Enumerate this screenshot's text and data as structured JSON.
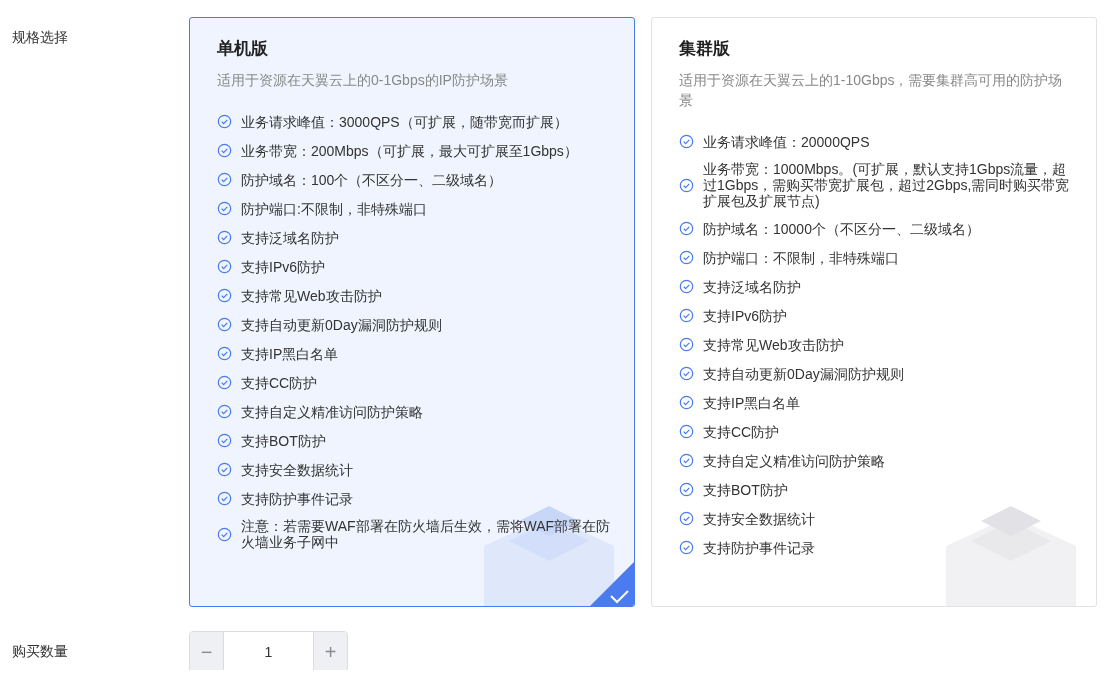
{
  "spec": {
    "label": "规格选择",
    "plans": [
      {
        "title": "单机版",
        "description": "适用于资源在天翼云上的0-1Gbps的IP防护场景",
        "selected": true,
        "features": [
          "业务请求峰值：3000QPS（可扩展，随带宽而扩展）",
          "业务带宽：200Mbps（可扩展，最大可扩展至1Gbps）",
          "防护域名：100个（不区分一、二级域名）",
          "防护端口:不限制，非特殊端口",
          "支持泛域名防护",
          "支持IPv6防护",
          "支持常见Web攻击防护",
          "支持自动更新0Day漏洞防护规则",
          "支持IP黑白名单",
          "支持CC防护",
          "支持自定义精准访问防护策略",
          "支持BOT防护",
          "支持安全数据统计",
          "支持防护事件记录",
          "注意：若需要WAF部署在防火墙后生效，需将WAF部署在防火墙业务子网中"
        ]
      },
      {
        "title": "集群版",
        "description": "适用于资源在天翼云上的1-10Gbps，需要集群高可用的防护场景",
        "selected": false,
        "features": [
          "业务请求峰值：20000QPS",
          "业务带宽：1000Mbps。(可扩展，默认支持1Gbps流量，超过1Gbps，需购买带宽扩展包，超过2Gbps,需同时购买带宽扩展包及扩展节点)",
          "防护域名：10000个（不区分一、二级域名）",
          "防护端口：不限制，非特殊端口",
          "支持泛域名防护",
          "支持IPv6防护",
          "支持常见Web攻击防护",
          "支持自动更新0Day漏洞防护规则",
          "支持IP黑白名单",
          "支持CC防护",
          "支持自定义精准访问防护策略",
          "支持BOT防护",
          "支持安全数据统计",
          "支持防护事件记录"
        ]
      }
    ]
  },
  "quantity": {
    "label": "购买数量",
    "value": "1",
    "decrement": {
      "text": "−",
      "disabled": true
    },
    "increment": {
      "text": "+",
      "disabled": true
    }
  }
}
